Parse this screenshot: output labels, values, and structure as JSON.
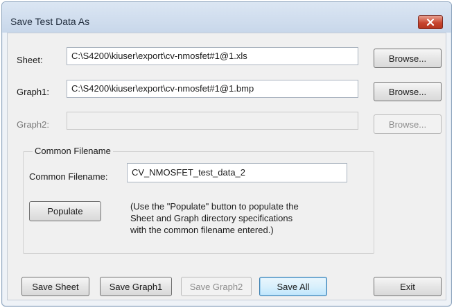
{
  "window": {
    "title": "Save Test Data As"
  },
  "sheet": {
    "label": "Sheet:",
    "value": "C:\\S4200\\kiuser\\export\\cv-nmosfet#1@1.xls",
    "browse": "Browse..."
  },
  "graph1": {
    "label": "Graph1:",
    "value": "C:\\S4200\\kiuser\\export\\cv-nmosfet#1@1.bmp",
    "browse": "Browse..."
  },
  "graph2": {
    "label": "Graph2:",
    "value": "",
    "browse": "Browse..."
  },
  "common": {
    "group_title": "Common Filename",
    "label": "Common Filename:",
    "value": "CV_NMOSFET_test_data_2",
    "populate": "Populate",
    "note": "(Use the \"Populate\" button to populate the\nSheet and Graph directory specifications\nwith the common filename entered.)"
  },
  "actions": {
    "save_sheet": "Save Sheet",
    "save_graph1": "Save Graph1",
    "save_graph2": "Save Graph2",
    "save_all": "Save All",
    "exit": "Exit"
  },
  "icons": {
    "close": "close-icon"
  },
  "colors": {
    "close_button": "#c8452f",
    "titlebar": "#c8d7ea",
    "focus_border": "#3c7fb1"
  }
}
